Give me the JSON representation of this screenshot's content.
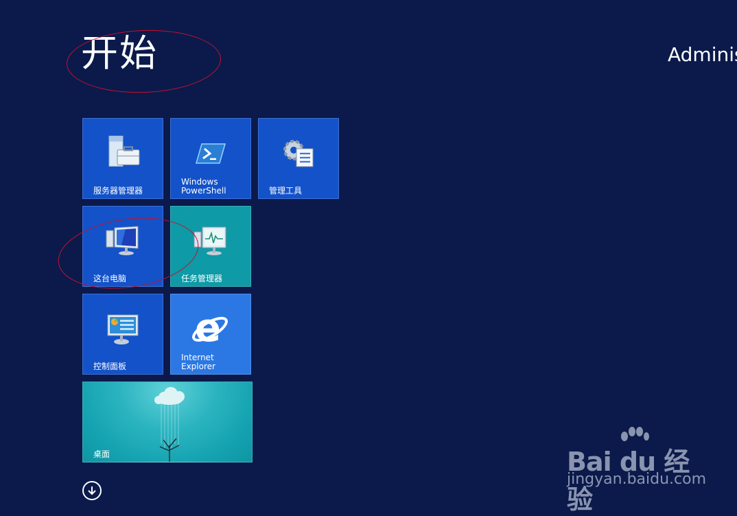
{
  "header": {
    "title": "开始",
    "user": "Adminis"
  },
  "tiles": [
    {
      "label": "服务器管理器"
    },
    {
      "label": "Windows\nPowerShell"
    },
    {
      "label": "管理工具"
    },
    {
      "label": "这台电脑"
    },
    {
      "label": "任务管理器"
    },
    {
      "label": "控制面板"
    },
    {
      "label": "Internet\nExplorer"
    },
    {
      "label": "桌面"
    }
  ],
  "watermark": {
    "logo": "Bai du 经验",
    "url": "jingyan.baidu.com"
  },
  "colors": {
    "background": "#0b1a4b",
    "tile_blue": "#1352c9",
    "tile_teal": "#0e9aa6",
    "tile_ie": "#2b78e4",
    "annotation": "#c8102e"
  }
}
